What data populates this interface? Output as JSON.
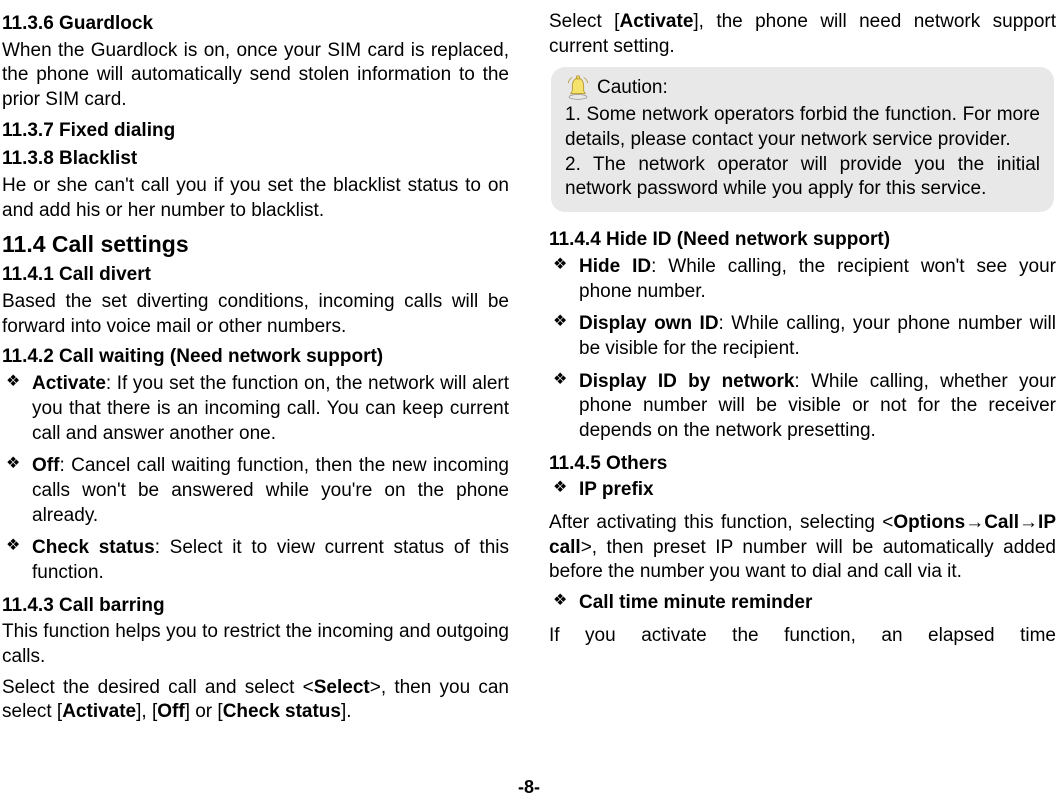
{
  "left": {
    "h1136": "11.3.6 Guardlock",
    "p1136": "When the Guardlock is on, once your SIM card is replaced, the phone will automatically send stolen information to the prior SIM card.",
    "h1137": "11.3.7 Fixed dialing",
    "h1138": "11.3.8 Blacklist",
    "p1138": "He or she can't call you if you set the blacklist status to on and add his or her number to blacklist.",
    "h114": "11.4 Call settings",
    "h1141": "11.4.1 Call divert",
    "p1141": "Based the set diverting conditions, incoming calls will be forward into voice mail or other numbers.",
    "h1142": "11.4.2 Call waiting (Need network support)",
    "li1142a_b": "Activate",
    "li1142a_t": ": If you set the function on, the network will alert you that there is an incoming call. You can keep current call and answer another one.",
    "li1142b_b": "Off",
    "li1142b_t": ": Cancel call waiting function, then the new incoming calls won't be answered while you're on the phone already.",
    "li1142c_b": "Check status",
    "li1142c_t": ": Select it to view current status of this function.",
    "h1143": "11.4.3 Call barring",
    "p1143a": "This function helps you to restrict the incoming and outgoing calls.",
    "p1143b_pre": "Select the desired call and select <",
    "p1143b_sel": "Select",
    "p1143b_mid": ">, then you can select [",
    "p1143b_act": "Activate",
    "p1143b_m2": "], [",
    "p1143b_off": "Off",
    "p1143b_m3": "] or [",
    "p1143b_chk": "Check status",
    "p1143b_end": "]."
  },
  "right": {
    "topline_pre": "Select [",
    "topline_act": "Activate",
    "topline_post": "], the phone will need network support current setting.",
    "caution_label": "Caution:",
    "caution_body": "1. Some network operators forbid the function. For more details, please contact your network service provider.\n2. The network operator will provide you the initial network password while you apply for this service.",
    "h1144": "11.4.4 Hide ID (Need network support)",
    "li1144a_b": "Hide ID",
    "li1144a_t": ": While calling, the recipient won't see your phone number.",
    "li1144b_b": "Display own ID",
    "li1144b_t": ": While calling, your phone number will be visible for the recipient.",
    "li1144c_b": "Display ID by network",
    "li1144c_t": ": While calling, whether your phone number will be visible or not for the receiver depends on the network presetting.",
    "h1145": "11.4.5 Others",
    "li_ipprefix": "IP prefix",
    "p_ipprefix_pre": "After activating this function, selecting <",
    "p_ipprefix_opt": "Options",
    "p_ipprefix_arrow1": "→",
    "p_ipprefix_call": "Call",
    "p_ipprefix_arrow2": "→",
    "p_ipprefix_ipcall": "IP call",
    "p_ipprefix_post": ">, then preset IP number will be automatically added before the number you want to dial and call via it.",
    "li_reminder": "Call time minute reminder",
    "p_reminder": "If you activate the function, an elapsed time"
  },
  "footer": "-8-"
}
